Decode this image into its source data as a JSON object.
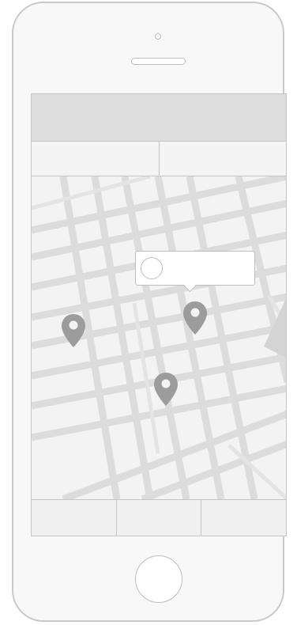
{
  "header": {
    "title": ""
  },
  "tabs": [
    {
      "label": ""
    },
    {
      "label": ""
    }
  ],
  "callout": {
    "text": ""
  },
  "map": {
    "pins": [
      {
        "name": "map-pin-left"
      },
      {
        "name": "map-pin-right"
      },
      {
        "name": "map-pin-bottom"
      }
    ]
  },
  "bottom_tabs": [
    {
      "label": ""
    },
    {
      "label": ""
    },
    {
      "label": ""
    }
  ],
  "colors": {
    "road": "#d9d9d9",
    "road_light": "#e6e6e6",
    "pin": "#9c9c9c",
    "map_bg": "#f3f3f3",
    "frame": "#c9c9c9"
  }
}
